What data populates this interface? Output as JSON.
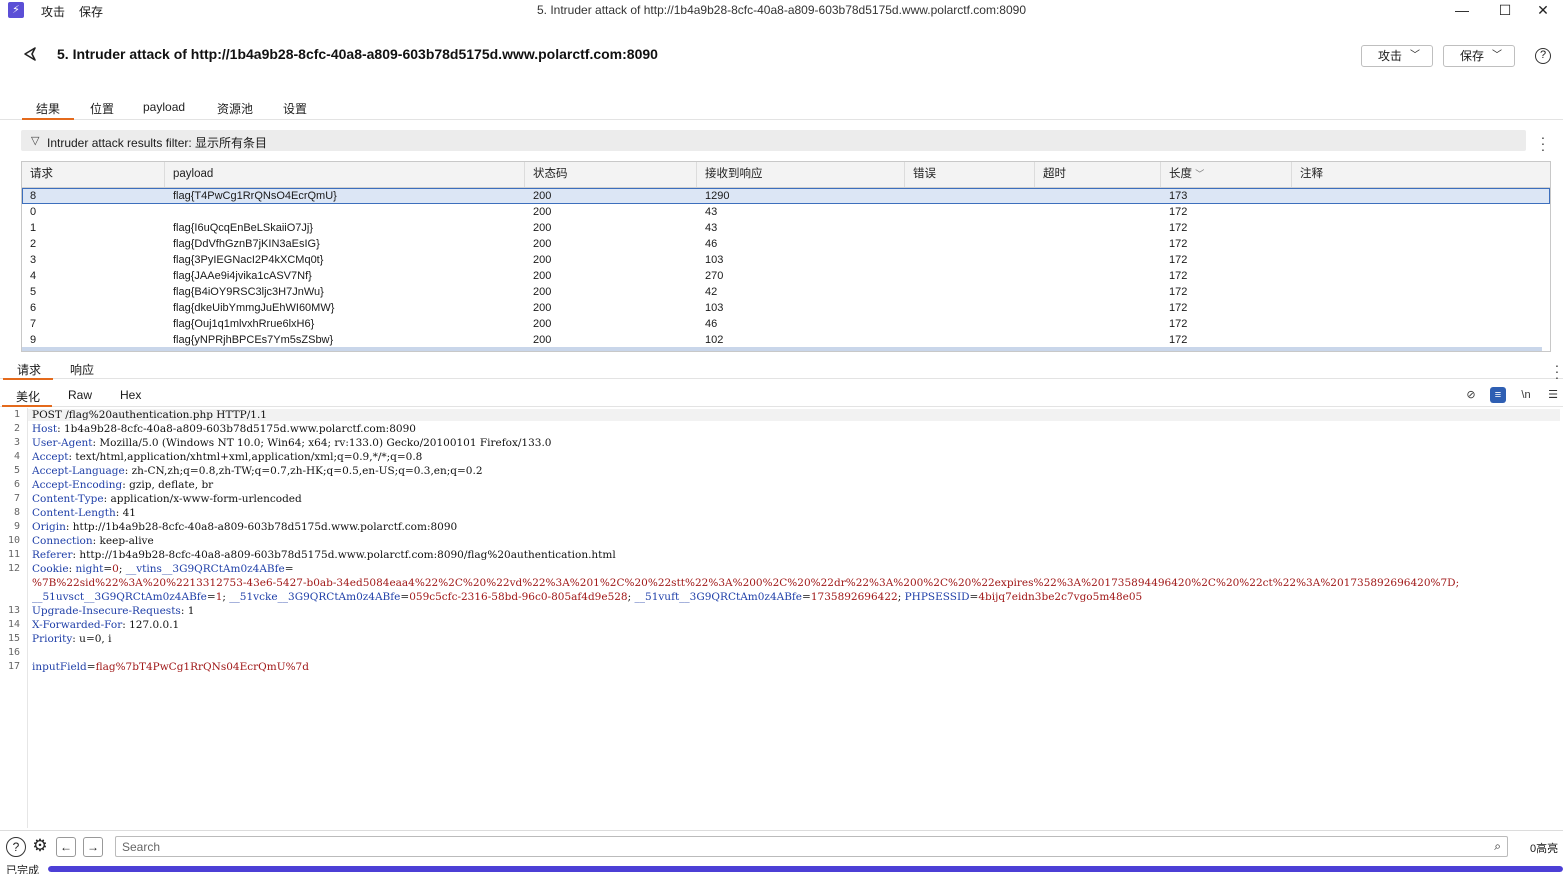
{
  "window": {
    "title": "5. Intruder attack of http://1b4a9b28-8cfc-40a8-a809-603b78d5175d.www.polarctf.com:8090",
    "menu": [
      "攻击",
      "保存"
    ],
    "logo_icon": "burp-logo-icon"
  },
  "header": {
    "title": "5. Intruder attack of http://1b4a9b28-8cfc-40a8-a809-603b78d5175d.www.polarctf.com:8090",
    "attack_button": "攻击",
    "save_button": "保存"
  },
  "tabs": [
    "结果",
    "位置",
    "payload",
    "资源池",
    "设置"
  ],
  "active_tab": "结果",
  "filter": {
    "text": "Intruder attack results filter: 显示所有条目"
  },
  "table": {
    "columns": [
      "请求",
      "payload",
      "状态码",
      "接收到响应",
      "错误",
      "超时",
      "长度",
      "注释"
    ],
    "sort_column": "长度",
    "rows": [
      [
        "8",
        "flag{T4PwCg1RrQNsO4EcrQmU}",
        "200",
        "1290",
        "",
        "",
        "173",
        ""
      ],
      [
        "0",
        "",
        "200",
        "43",
        "",
        "",
        "172",
        ""
      ],
      [
        "1",
        "flag{I6uQcqEnBeLSkaiiO7Jj}",
        "200",
        "43",
        "",
        "",
        "172",
        ""
      ],
      [
        "2",
        "flag{DdVfhGznB7jKIN3aEsIG}",
        "200",
        "46",
        "",
        "",
        "172",
        ""
      ],
      [
        "3",
        "flag{3PyIEGNacI2P4kXCMq0t}",
        "200",
        "103",
        "",
        "",
        "172",
        ""
      ],
      [
        "4",
        "flag{JAAe9i4jvika1cASV7Nf}",
        "200",
        "270",
        "",
        "",
        "172",
        ""
      ],
      [
        "5",
        "flag{B4iOY9RSC3ljc3H7JnWu}",
        "200",
        "42",
        "",
        "",
        "172",
        ""
      ],
      [
        "6",
        "flag{dkeUibYmmgJuEhWI60MW}",
        "200",
        "103",
        "",
        "",
        "172",
        ""
      ],
      [
        "7",
        "flag{Ouj1q1mlvxhRrue6lxH6}",
        "200",
        "46",
        "",
        "",
        "172",
        ""
      ],
      [
        "9",
        "flag{yNPRjhBPCEs7Ym5sZSbw}",
        "200",
        "102",
        "",
        "",
        "172",
        ""
      ]
    ],
    "selected_row": 0
  },
  "req_resp_tabs": [
    "请求",
    "响应"
  ],
  "active_req_resp": "请求",
  "view_tabs": [
    "美化",
    "Raw",
    "Hex"
  ],
  "active_view": "美化",
  "editor_tools": [
    "eye-off-icon",
    "wrap-icon",
    "newline-icon",
    "menu-icon"
  ],
  "request_lines": [
    {
      "n": "1",
      "text": "POST /flag%20authentication.php HTTP/1.1"
    },
    {
      "n": "2",
      "k": "Host",
      "v": " 1b4a9b28-8cfc-40a8-a809-603b78d5175d.www.polarctf.com:8090"
    },
    {
      "n": "3",
      "k": "User-Agent",
      "v": " Mozilla/5.0 (Windows NT 10.0; Win64; x64; rv:133.0) Gecko/20100101 Firefox/133.0"
    },
    {
      "n": "4",
      "k": "Accept",
      "v": " text/html,application/xhtml+xml,application/xml;q=0.9,*/*;q=0.8"
    },
    {
      "n": "5",
      "k": "Accept-Language",
      "v": " zh-CN,zh;q=0.8,zh-TW;q=0.7,zh-HK;q=0.5,en-US;q=0.3,en;q=0.2"
    },
    {
      "n": "6",
      "k": "Accept-Encoding",
      "v": " gzip, deflate, br"
    },
    {
      "n": "7",
      "k": "Content-Type",
      "v": " application/x-www-form-urlencoded"
    },
    {
      "n": "8",
      "k": "Content-Length",
      "v": " 41"
    },
    {
      "n": "9",
      "k": "Origin",
      "v": " http://1b4a9b28-8cfc-40a8-a809-603b78d5175d.www.polarctf.com:8090"
    },
    {
      "n": "10",
      "k": "Connection",
      "v": " keep-alive"
    },
    {
      "n": "11",
      "k": "Referer",
      "v": " http://1b4a9b28-8cfc-40a8-a809-603b78d5175d.www.polarctf.com:8090/flag%20authentication.html"
    }
  ],
  "cookie": {
    "n": "12",
    "label": "Cookie",
    "c1k": "night",
    "c1v": "0",
    "c2k": "__vtins__3G9QRCtAm0z4ABfe",
    "line2": "%7B%22sid%22%3A%20%2213312753-43e6-5427-b0ab-34ed5084eaa4%22%2C%20%22vd%22%3A%201%2C%20%22stt%22%3A%200%2C%20%22dr%22%3A%200%2C%20%22expires%22%3A%201735894496420%2C%20%22ct%22%3A%201735892696420%7D;",
    "c3k": "__51uvsct__3G9QRCtAm0z4ABfe",
    "c3v": "1",
    "c4k": "__51vcke__3G9QRCtAm0z4ABfe",
    "c4v": "059c5cfc-2316-58bd-96c0-805af4d9e528",
    "c5k": "__51vuft__3G9QRCtAm0z4ABfe",
    "c5v": "1735892696422",
    "c6k": "PHPSESSID",
    "c6v": "4bijq7eidn3be2c7vgo5m48e05"
  },
  "request_tail": [
    {
      "n": "13",
      "k": "Upgrade-Insecure-Requests",
      "v": " 1"
    },
    {
      "n": "14",
      "k": "X-Forwarded-For",
      "v": " 127.0.0.1"
    },
    {
      "n": "15",
      "k": "Priority",
      "v": " u=0, i"
    },
    {
      "n": "16",
      "k": "",
      "v": ""
    }
  ],
  "body_line": {
    "n": "17",
    "k": "inputField",
    "v": "flag%7bT4PwCg1RrQNs04EcrQmU%7d"
  },
  "search": {
    "placeholder": "Search",
    "highlight_count": "0高亮"
  },
  "status": {
    "text": "已完成",
    "progress": 1.0
  },
  "colors": {
    "accent": "#e46a1c",
    "selection": "#dce6f5",
    "progress": "#4c3fd6"
  }
}
